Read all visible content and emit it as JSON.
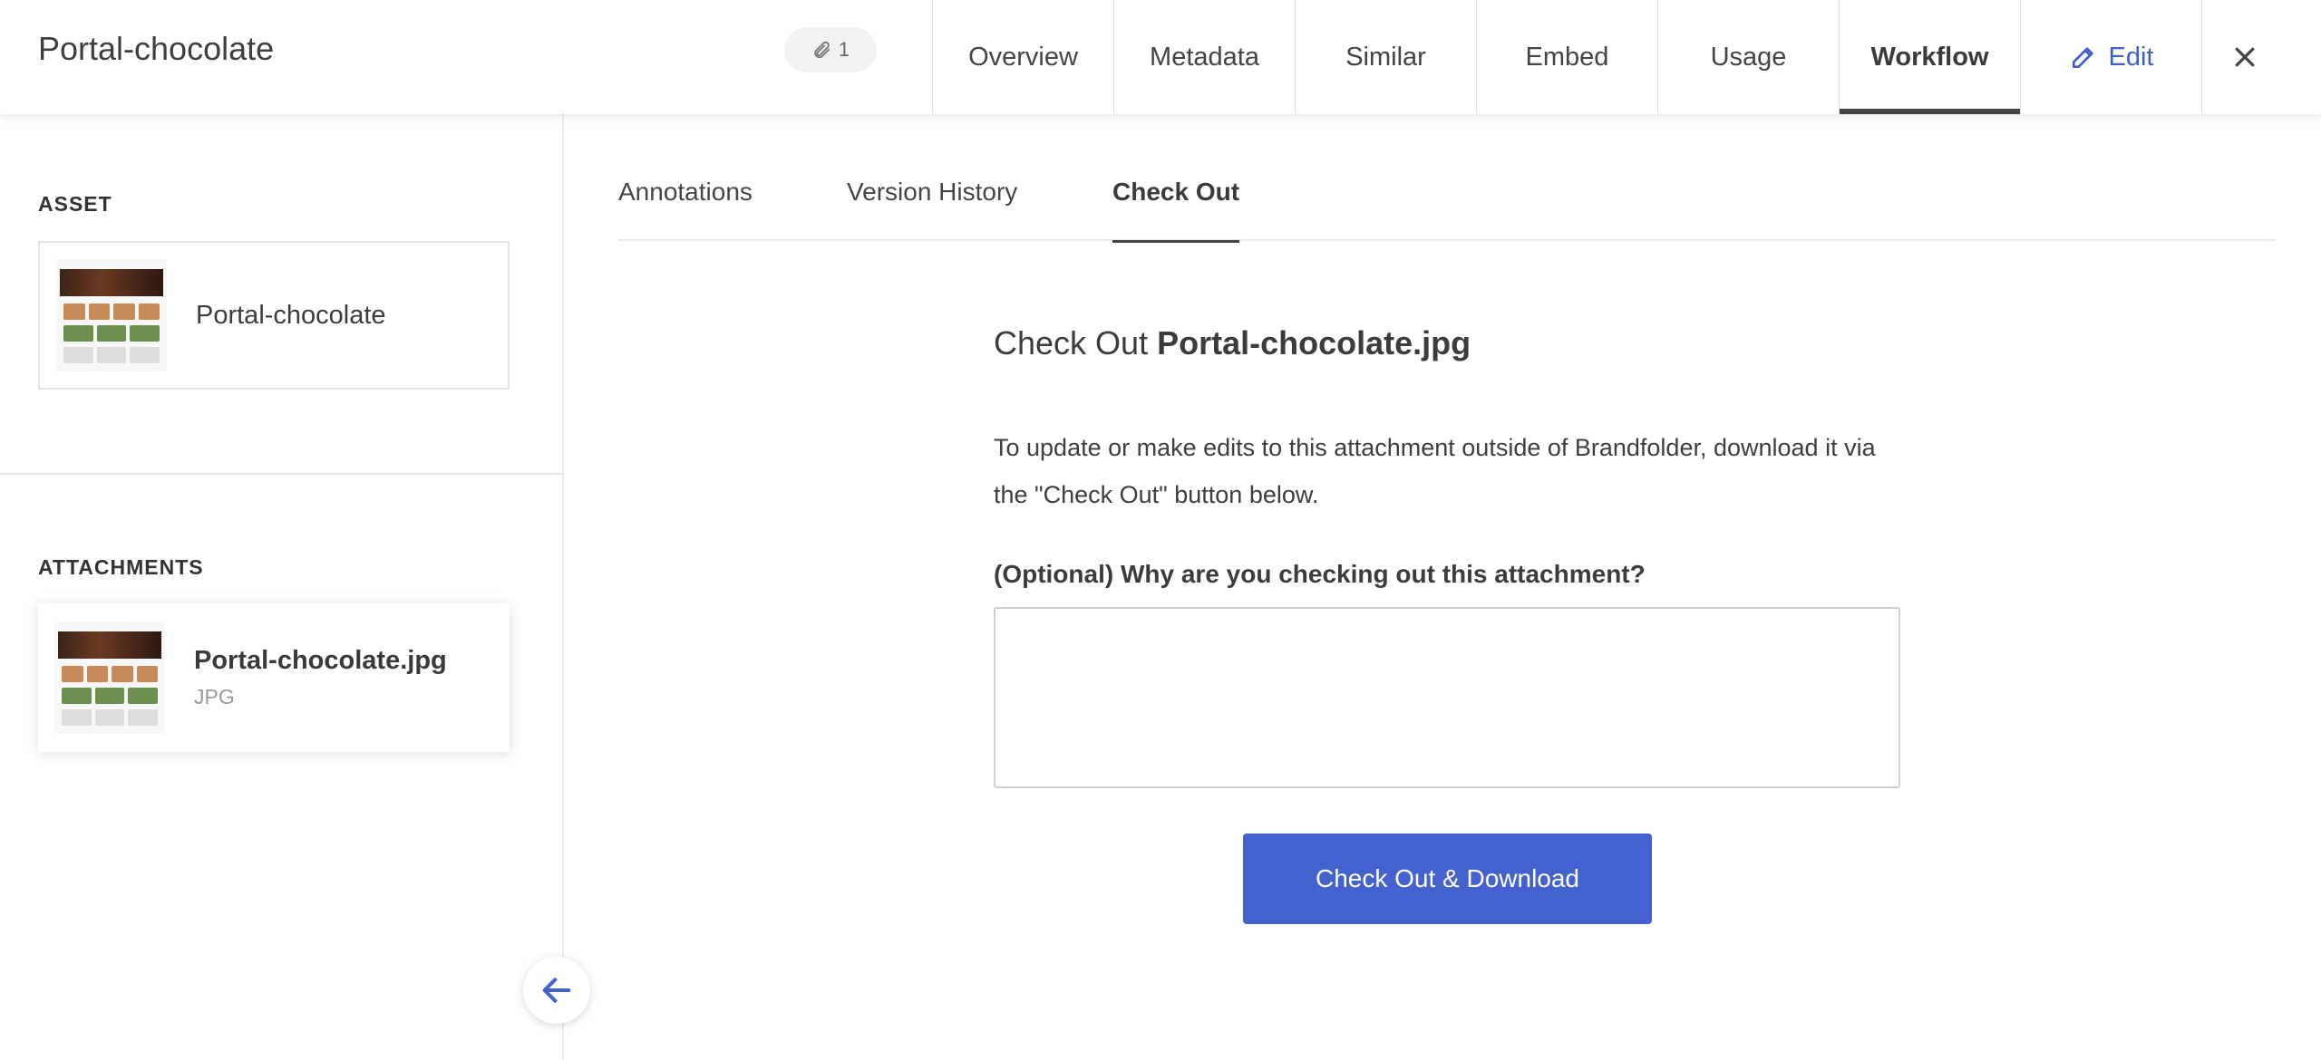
{
  "header": {
    "title": "Portal-chocolate",
    "attachment_count": "1",
    "tabs": [
      {
        "label": "Overview"
      },
      {
        "label": "Metadata"
      },
      {
        "label": "Similar"
      },
      {
        "label": "Embed"
      },
      {
        "label": "Usage"
      },
      {
        "label": "Workflow",
        "active": true
      }
    ],
    "edit_label": "Edit"
  },
  "sidebar": {
    "asset_label": "ASSET",
    "asset_name": "Portal-chocolate",
    "attachments_label": "ATTACHMENTS",
    "attachment": {
      "name": "Portal-chocolate.jpg",
      "type": "JPG"
    }
  },
  "subtabs": [
    {
      "label": "Annotations"
    },
    {
      "label": "Version History"
    },
    {
      "label": "Check Out",
      "active": true
    }
  ],
  "checkout": {
    "title_prefix": "Check Out",
    "title_file": "Portal-chocolate.jpg",
    "description": "To update or make edits to this attachment outside of Brandfolder, download it via the \"Check Out\" button below.",
    "reason_label": "(Optional) Why are you checking out this attachment?",
    "reason_value": "",
    "reason_placeholder": "",
    "button_label": "Check Out & Download"
  },
  "colors": {
    "accent": "#4361cf",
    "edit_link": "#3f5fc8"
  }
}
